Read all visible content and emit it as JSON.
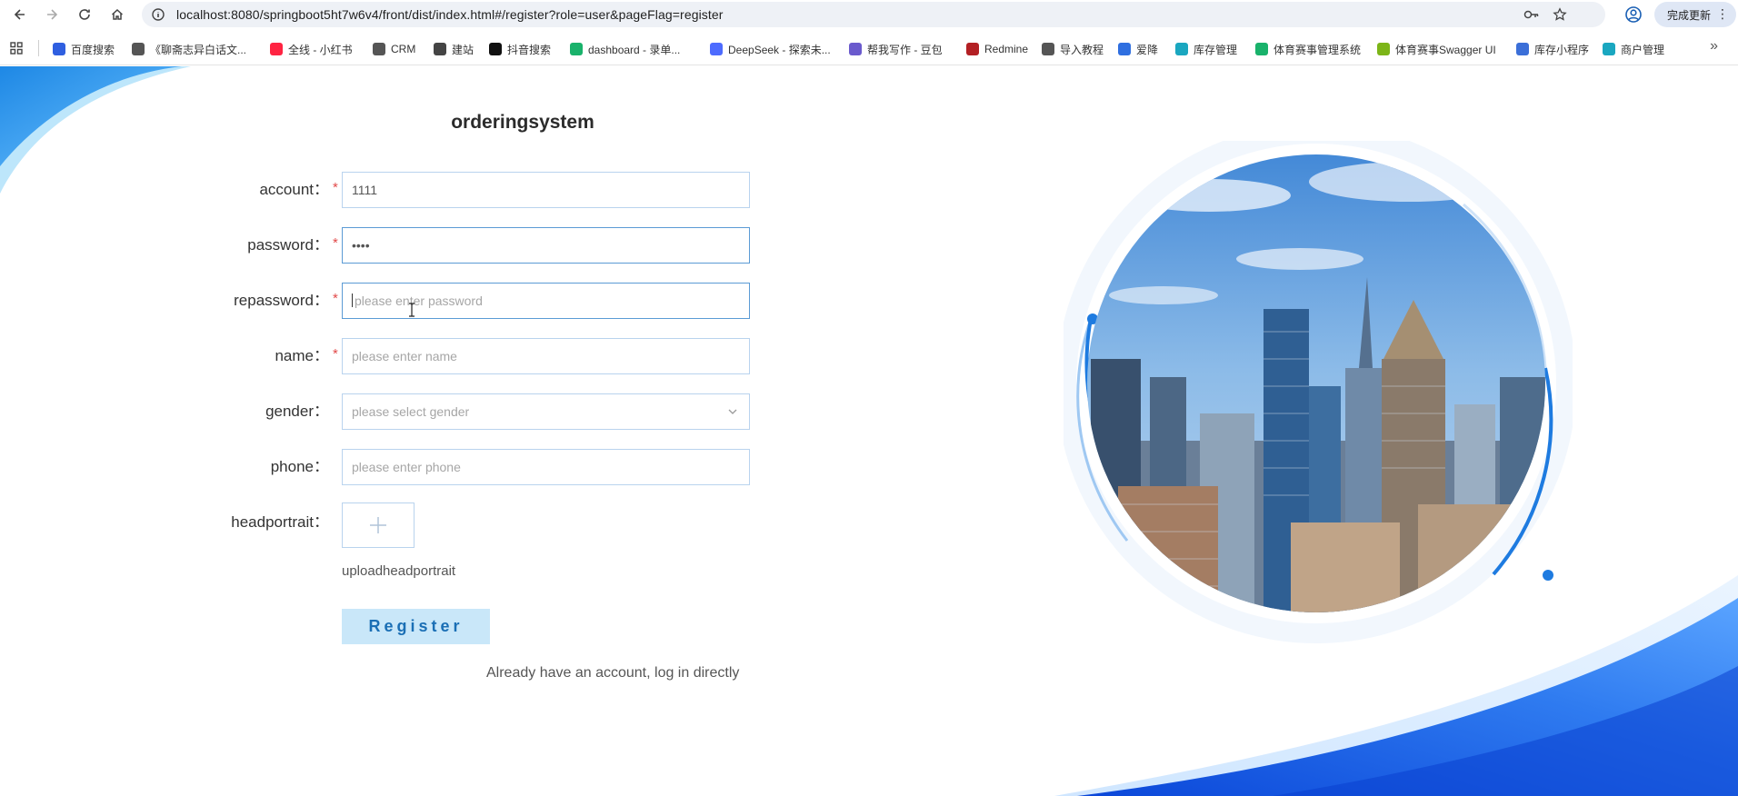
{
  "browser": {
    "url": "localhost:8080/springboot5ht7w6v4/front/dist/index.html#/register?role=user&pageFlag=register",
    "update_label": "完成更新",
    "bookmarks": [
      {
        "label": "百度搜索",
        "color": "#2f5fe0"
      },
      {
        "label": "《聊斋志异白话文...",
        "color": "#555555"
      },
      {
        "label": "全线 - 小红书",
        "color": "#ff2442"
      },
      {
        "label": "CRM",
        "color": "#555555"
      },
      {
        "label": "建站",
        "color": "#444444"
      },
      {
        "label": "抖音搜索",
        "color": "#111111"
      },
      {
        "label": "dashboard - 录单...",
        "color": "#19b26b"
      },
      {
        "label": "DeepSeek - 探索未...",
        "color": "#4d6bfe"
      },
      {
        "label": "帮我写作 - 豆包",
        "color": "#6a5acd"
      },
      {
        "label": "Redmine",
        "color": "#b32024"
      },
      {
        "label": "导入教程",
        "color": "#555555"
      },
      {
        "label": "爱降",
        "color": "#2f6fe0"
      },
      {
        "label": "库存管理",
        "color": "#1aa7c0"
      },
      {
        "label": "体育赛事管理系统",
        "color": "#19b26b"
      },
      {
        "label": "体育赛事Swagger UI",
        "color": "#7cb518"
      },
      {
        "label": "库存小程序",
        "color": "#3b6fd8"
      },
      {
        "label": "商户管理",
        "color": "#1aa7c0"
      }
    ]
  },
  "page": {
    "title": "orderingsystem",
    "fields": [
      {
        "label": "account：",
        "required": true,
        "value": "1111",
        "placeholder": ""
      },
      {
        "label": "password：",
        "required": true,
        "value": "••••",
        "placeholder": ""
      },
      {
        "label": "repassword：",
        "required": true,
        "value": "",
        "placeholder": "please enter password"
      },
      {
        "label": "name：",
        "required": true,
        "value": "",
        "placeholder": "please enter name"
      },
      {
        "label": "gender：",
        "required": false,
        "value": "",
        "placeholder": "please select gender"
      },
      {
        "label": "phone：",
        "required": false,
        "value": "",
        "placeholder": "please enter phone"
      }
    ],
    "headportrait_label": "headportrait：",
    "upload_label": "uploadheadportrait",
    "register_label": "Register",
    "login_link": "Already have an account, log in directly",
    "required_mark": "*"
  },
  "colors": {
    "accent": "#1b6fb5",
    "button_bg": "#c9e7f9",
    "border": "#b9d3ee",
    "required": "#e24a4a"
  }
}
